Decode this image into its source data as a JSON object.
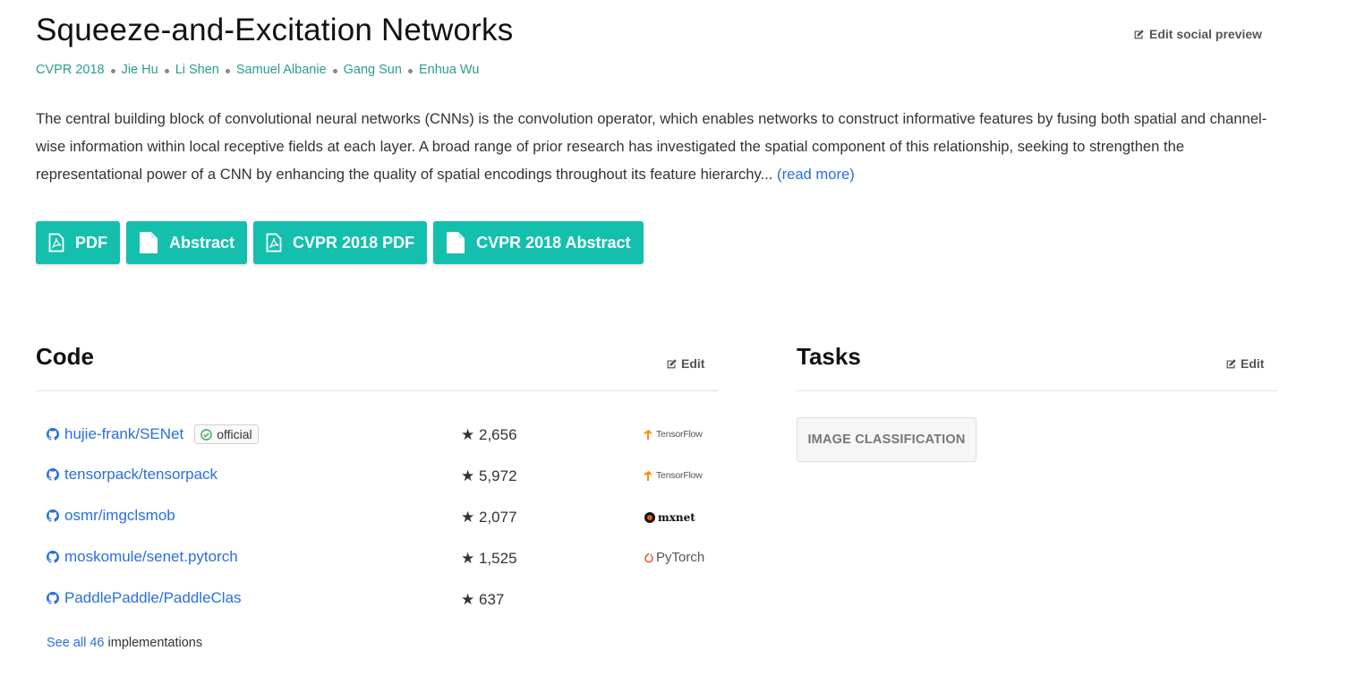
{
  "paper": {
    "title": "Squeeze-and-Excitation Networks",
    "edit_social_preview": "Edit social preview",
    "conference": "CVPR 2018",
    "authors": [
      "Jie Hu",
      "Li Shen",
      "Samuel Albanie",
      "Gang Sun",
      "Enhua Wu"
    ],
    "abstract": "The central building block of convolutional neural networks (CNNs) is the convolution operator, which enables networks to construct informative features by fusing both spatial and channel-wise information within local receptive fields at each layer. A broad range of prior research has investigated the spatial component of this relationship, seeking to strengthen the representational power of a CNN by enhancing the quality of spatial encodings throughout its feature hierarchy...",
    "read_more": "(read more)"
  },
  "buttons": [
    {
      "label": "PDF",
      "icon": "pdf-icon"
    },
    {
      "label": "Abstract",
      "icon": "document-icon"
    },
    {
      "label": "CVPR 2018 PDF",
      "icon": "pdf-icon"
    },
    {
      "label": "CVPR 2018 Abstract",
      "icon": "document-icon"
    }
  ],
  "code": {
    "title": "Code",
    "edit_label": "Edit",
    "rows": [
      {
        "repo": "hujie-frank/SENet",
        "official": "official",
        "stars": "2,656",
        "framework": "TensorFlow"
      },
      {
        "repo": "tensorpack/tensorpack",
        "official": "",
        "stars": "5,972",
        "framework": "TensorFlow"
      },
      {
        "repo": "osmr/imgclsmob",
        "official": "",
        "stars": "2,077",
        "framework": "mxnet"
      },
      {
        "repo": "moskomule/senet.pytorch",
        "official": "",
        "stars": "1,525",
        "framework": "PyTorch"
      },
      {
        "repo": "PaddlePaddle/PaddleClas",
        "official": "",
        "stars": "637",
        "framework": ""
      }
    ],
    "see_all_link": "See all 46",
    "see_all_suffix": " implementations"
  },
  "tasks": {
    "title": "Tasks",
    "edit_label": "Edit",
    "items": [
      "IMAGE CLASSIFICATION"
    ]
  },
  "colors": {
    "accent": "#14bfae",
    "link": "#2a6fdb",
    "author": "#2b9c94"
  }
}
